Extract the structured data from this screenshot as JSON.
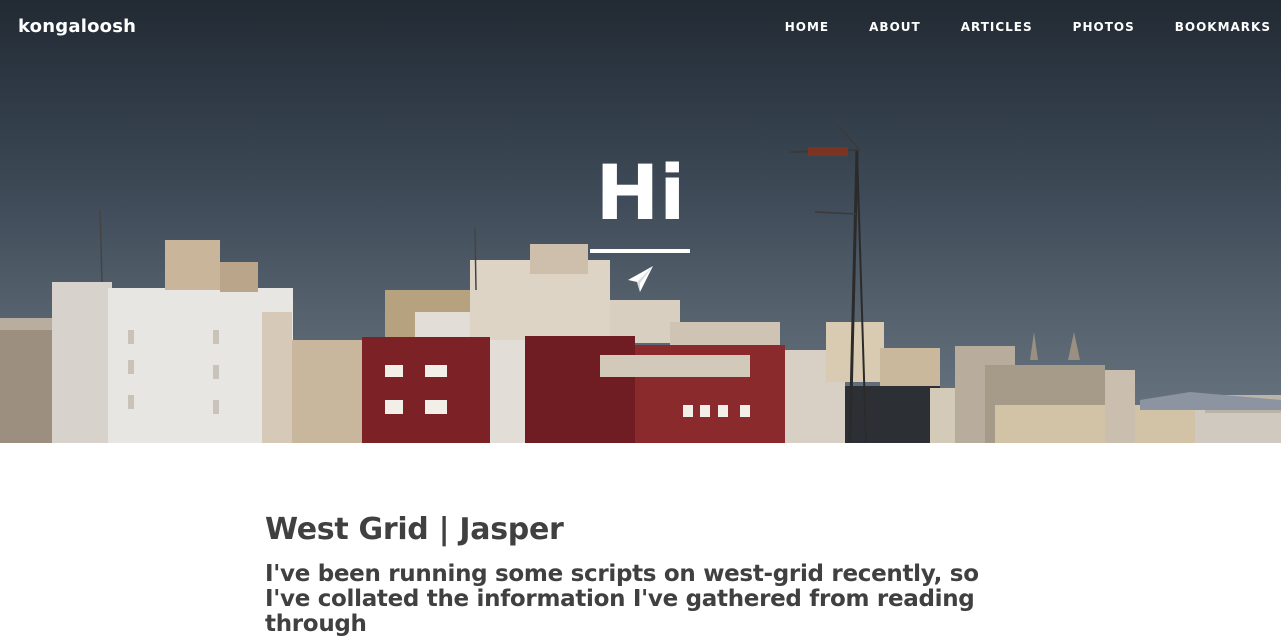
{
  "brand": {
    "name": "kongaloosh"
  },
  "nav": {
    "items": [
      {
        "label": "HOME"
      },
      {
        "label": "ABOUT"
      },
      {
        "label": "ARTICLES"
      },
      {
        "label": "PHOTOS"
      },
      {
        "label": "BOOKMARKS"
      }
    ]
  },
  "hero": {
    "title": "Hi",
    "icon": "paper-plane-icon"
  },
  "post": {
    "title": "West Grid | Jasper",
    "subtitle": "I've been running some scripts on west-grid recently, so I've collated the information I've gathered from reading through"
  },
  "colors": {
    "text": "#404040",
    "nav_text": "#ffffff",
    "background": "#ffffff"
  }
}
